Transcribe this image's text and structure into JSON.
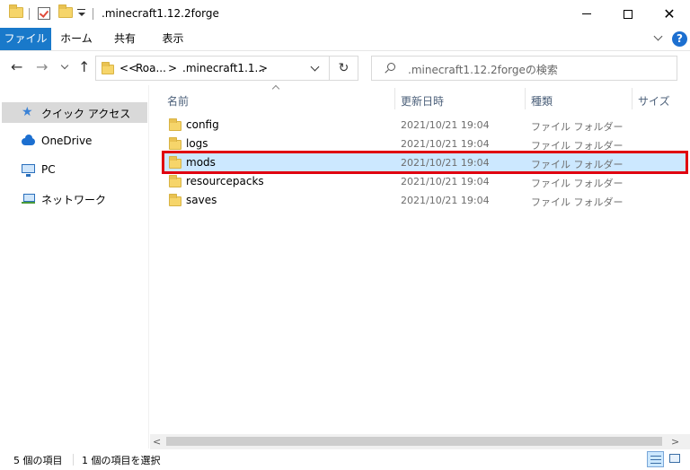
{
  "window": {
    "title": ".minecraft1.12.2forge"
  },
  "ribbon": {
    "tabs": [
      "ファイル",
      "ホーム",
      "共有",
      "表示"
    ],
    "help_glyph": "?"
  },
  "navigation": {
    "back_glyph": "←",
    "forward_glyph": "→",
    "up_glyph": "↑",
    "breadcrumb": [
      "<<",
      "Roa...",
      ">",
      ".minecraft1.1...",
      ">"
    ],
    "refresh_glyph": "↻",
    "search_placeholder": ".minecraft1.12.2forgeの検索"
  },
  "sidebar": {
    "items": [
      {
        "label": "クイック アクセス",
        "icon": "star-icon",
        "selected": true
      },
      {
        "label": "OneDrive",
        "icon": "cloud-icon",
        "selected": false
      },
      {
        "label": "PC",
        "icon": "pc-icon",
        "selected": false
      },
      {
        "label": "ネットワーク",
        "icon": "network-icon",
        "selected": false
      }
    ]
  },
  "filelist": {
    "columns": [
      "名前",
      "更新日時",
      "種類",
      "サイズ"
    ],
    "rows": [
      {
        "name": "config",
        "date": "2021/10/21 19:04",
        "type": "ファイル フォルダー",
        "selected": false
      },
      {
        "name": "logs",
        "date": "2021/10/21 19:04",
        "type": "ファイル フォルダー",
        "selected": false
      },
      {
        "name": "mods",
        "date": "2021/10/21 19:04",
        "type": "ファイル フォルダー",
        "selected": true
      },
      {
        "name": "resourcepacks",
        "date": "2021/10/21 19:04",
        "type": "ファイル フォルダー",
        "selected": false
      },
      {
        "name": "saves",
        "date": "2021/10/21 19:04",
        "type": "ファイル フォルダー",
        "selected": false
      }
    ]
  },
  "scrollbar": {
    "left_glyph": "<",
    "right_glyph": ">"
  },
  "status": {
    "item_count": "5 個の項目",
    "selected_count": "1 個の項目を選択"
  },
  "colors": {
    "accent": "#1979ca",
    "selection": "#cce8ff",
    "highlight": "#e0000f"
  }
}
